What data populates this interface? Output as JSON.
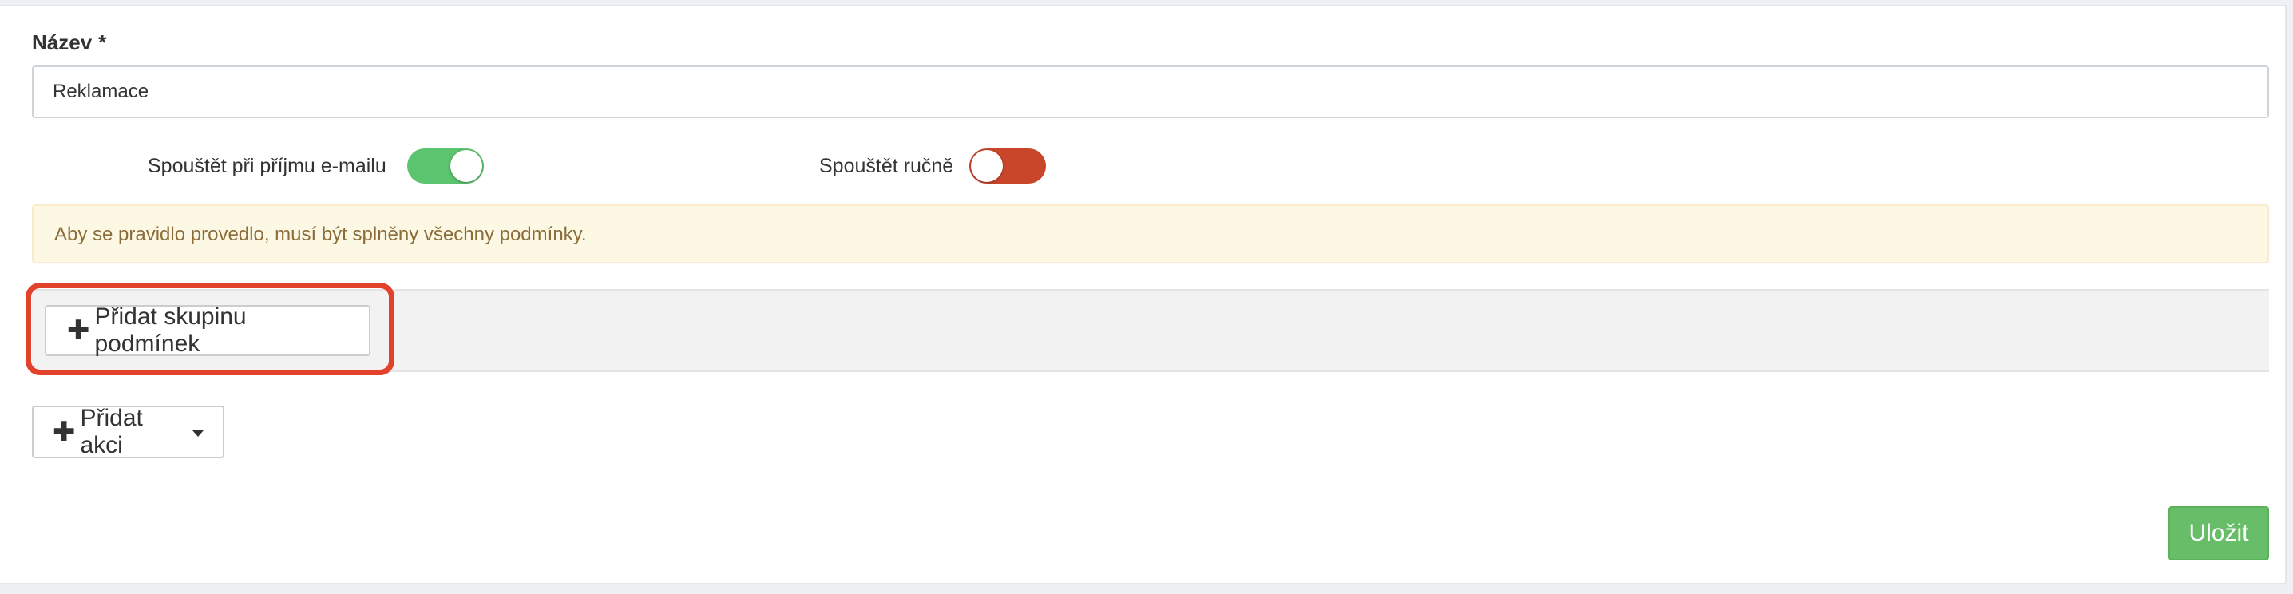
{
  "form": {
    "name_label": "Název",
    "required_mark": "*",
    "name_value": "Reklamace"
  },
  "toggles": {
    "on_email": {
      "label": "Spouštět při příjmu e-mailu",
      "state": true,
      "color": "#5cc36f"
    },
    "manual": {
      "label": "Spouštět ručně",
      "state": false,
      "color": "#c9462b"
    }
  },
  "alert": {
    "text": "Aby se pravidlo provedlo, musí být splněny všechny podmínky."
  },
  "conditions": {
    "add_group_label": "Přidat skupinu podmínek",
    "plus_icon": "✚"
  },
  "actions": {
    "add_action_label": "Přidat akci",
    "plus_icon": "✚"
  },
  "footer": {
    "save_label": "Uložit",
    "save_color": "#5cb85c"
  },
  "highlight_color": "#e2412c"
}
